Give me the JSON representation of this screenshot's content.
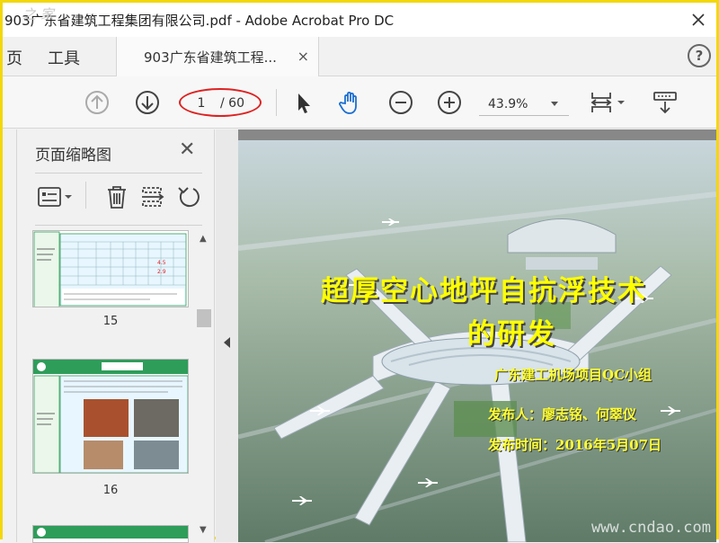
{
  "window": {
    "title": "903广东省建筑工程集团有限公司.pdf - Adobe Acrobat Pro DC",
    "watermark_top": "之 家"
  },
  "nav": {
    "home_label": "页",
    "tools_label": "工具",
    "tab_label": "903广东省建筑工程...",
    "tab_close": "×",
    "help": "?"
  },
  "toolbar": {
    "current_page": "1",
    "total_pages": "/ 60",
    "zoom": "43.9%"
  },
  "panel": {
    "title": "页面缩略图",
    "close": "✕",
    "thumbnails": [
      {
        "page": "15"
      },
      {
        "page": "16"
      }
    ]
  },
  "slide": {
    "title_line1": "超厚空心地坪自抗浮技术",
    "title_line2": "的研发",
    "org": "广东建工机场项目QC小组",
    "author": "发布人：廖志铭、何翠仪",
    "date": "发布时间：2016年5月07日"
  },
  "watermark": "www.cndao.com",
  "colors": {
    "slide_title": "#ffff00",
    "annotation_ring": "#dd2222",
    "thumb_green": "#2e9d5a"
  }
}
